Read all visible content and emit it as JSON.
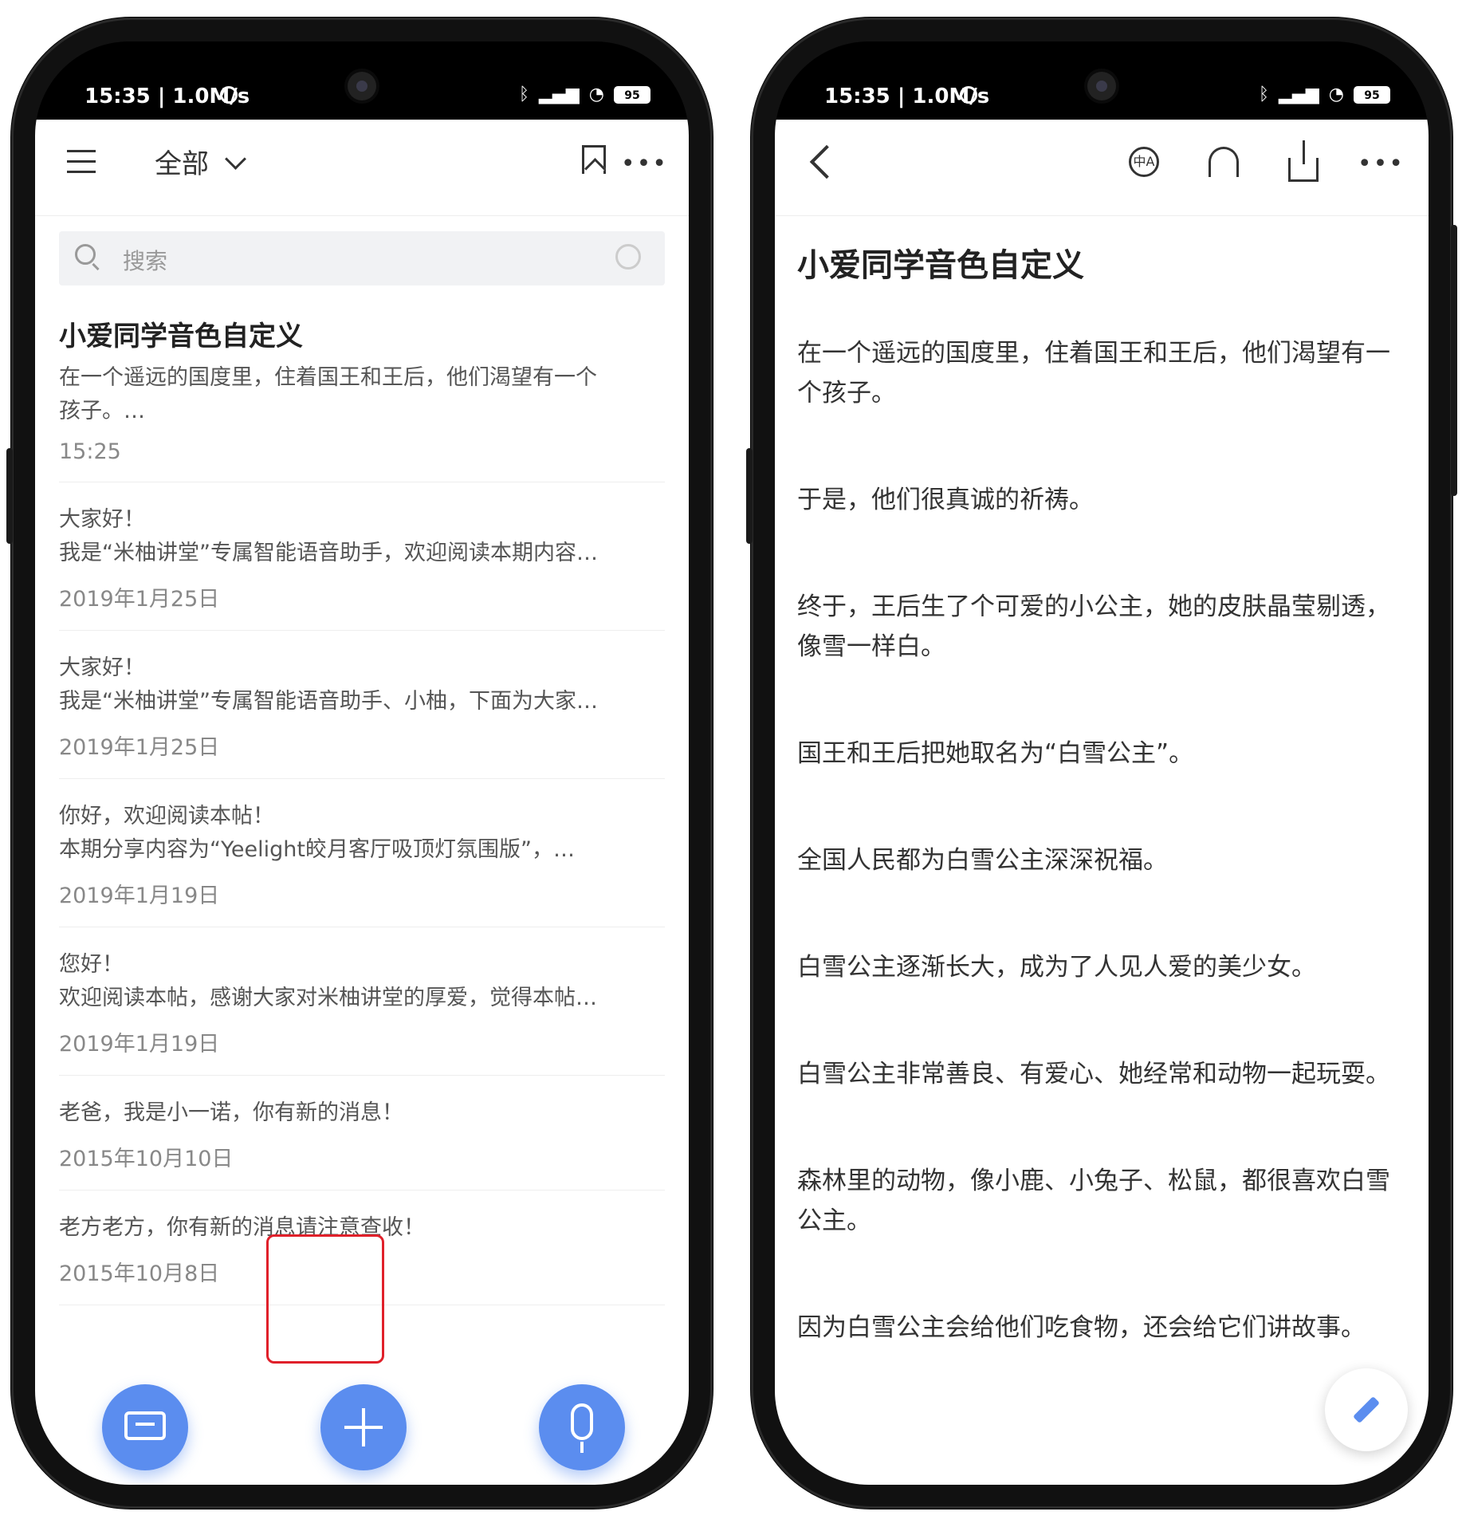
{
  "status": {
    "time": "15:35 | 1.0M/s",
    "battery": "95"
  },
  "left": {
    "filter_label": "全部",
    "search_placeholder": "搜索",
    "notes": [
      {
        "title": "小爱同学音色自定义",
        "lines": [
          "在一个遥远的国度里，住着国王和王后，他们渴望有一个",
          "孩子。…"
        ],
        "date": "15:25"
      },
      {
        "title": "",
        "lines": [
          "大家好！",
          "我是“米柚讲堂”专属智能语音助手，欢迎阅读本期内容…"
        ],
        "date": "2019年1月25日"
      },
      {
        "title": "",
        "lines": [
          "大家好！",
          "我是“米柚讲堂”专属智能语音助手、小柚，下面为大家…"
        ],
        "date": "2019年1月25日"
      },
      {
        "title": "",
        "lines": [
          "你好，欢迎阅读本帖！",
          "本期分享内容为“Yeelight皎月客厅吸顶灯氛围版”，…"
        ],
        "date": "2019年1月19日"
      },
      {
        "title": "",
        "lines": [
          "您好！",
          "欢迎阅读本帖，感谢大家对米柚讲堂的厚爱，觉得本帖…"
        ],
        "date": "2019年1月19日"
      },
      {
        "title": "",
        "lines": [
          "老爸，我是小一诺，你有新的消息！"
        ],
        "date": "2015年10月10日"
      },
      {
        "title": "",
        "lines": [
          "老方老方，你有新的消息请注意查收！"
        ],
        "date": "2015年10月8日"
      }
    ],
    "accent_color": "#5b8def",
    "highlight_color": "#e0202a"
  },
  "right": {
    "title": "小爱同学音色自定义",
    "translate_icon_text": "中A",
    "paragraphs": [
      "在一个遥远的国度里，住着国王和王后，他们渴望有一个孩子。",
      "于是，他们很真诚的祈祷。",
      "终于，王后生了个可爱的小公主，她的皮肤晶莹剔透，像雪一样白。",
      "国王和王后把她取名为“白雪公主”。",
      "全国人民都为白雪公主深深祝福。",
      "白雪公主逐渐长大，成为了人见人爱的美少女。",
      "白雪公主非常善良、有爱心、她经常和动物一起玩耍。",
      "森林里的动物，像小鹿、小兔子、松鼠，都很喜欢白雪公主。",
      "因为白雪公主会给他们吃食物，还会给它们讲故事。"
    ]
  }
}
